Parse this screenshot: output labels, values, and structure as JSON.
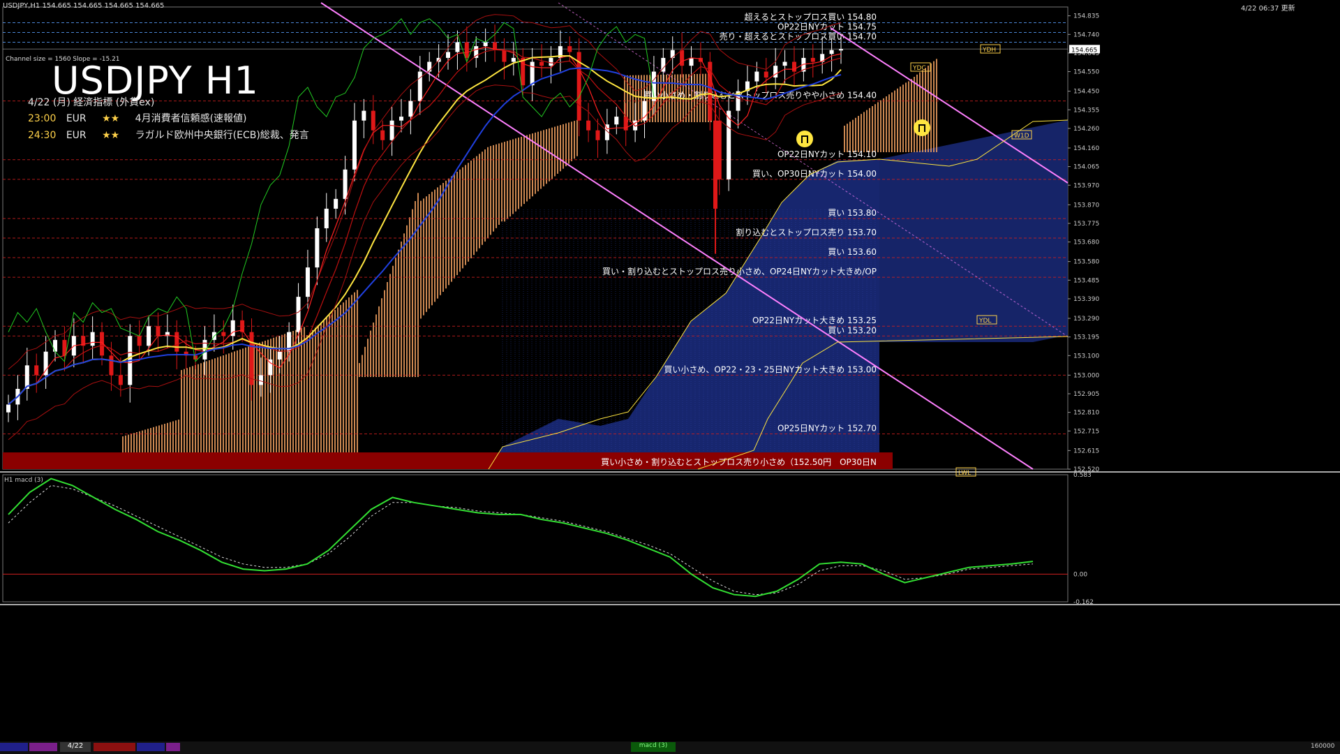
{
  "header": {
    "symbol_info": "USDJPY,H1  154.665 154.665 154.665 154.665",
    "timestamp": "4/22 06:37 更新",
    "channel_info": "Channel size = 1560 Slope = -15.21"
  },
  "title": "USDJPY H1",
  "events": {
    "heading": "4/22 (月) 経済指標 (外貨ex)",
    "items": [
      {
        "time": "23:00",
        "currency": "EUR",
        "stars": "★★",
        "name": "4月消費者信頼感(速報値)"
      },
      {
        "time": "24:30",
        "currency": "EUR",
        "stars": "★★",
        "name": "ラガルド欧州中央銀行(ECB)総裁、発言"
      }
    ]
  },
  "price_levels": [
    {
      "price": 154.8,
      "label": "超えるとストップロス買い 154.80",
      "color": "#5aa0ff",
      "style": "dash"
    },
    {
      "price": 154.75,
      "label": "OP22日NYカット 154.75",
      "color": "#5aa0ff",
      "style": "dash"
    },
    {
      "price": 154.7,
      "label": "売り・超えるとストップロス買い 154.70",
      "color": "#5aa0ff",
      "style": "dash"
    },
    {
      "price": 154.4,
      "label": "買い小さめ・割り込むとストップロス売りやや小さめ 154.40",
      "color": "#d02020",
      "style": "dash"
    },
    {
      "price": 154.1,
      "label": "OP22日NYカット 154.10",
      "color": "#d02020",
      "style": "dash"
    },
    {
      "price": 154.0,
      "label": "買い、OP30日NYカット 154.00",
      "color": "#d02020",
      "style": "dash"
    },
    {
      "price": 153.8,
      "label": "買い 153.80",
      "color": "#d02020",
      "style": "dash"
    },
    {
      "price": 153.7,
      "label": "割り込むとストップロス売り 153.70",
      "color": "#d02020",
      "style": "dash"
    },
    {
      "price": 153.6,
      "label": "買い 153.60",
      "color": "#d02020",
      "style": "dash"
    },
    {
      "price": 153.5,
      "label": "買い・割り込むとストップロス売り小さめ、OP24日NYカット大きめ/OP",
      "color": "#d02020",
      "style": "dash"
    },
    {
      "price": 153.25,
      "label": "OP22日NYカット大きめ 153.25",
      "color": "#d02020",
      "style": "dash"
    },
    {
      "price": 153.2,
      "label": "買い 153.20",
      "color": "#d02020",
      "style": "dash"
    },
    {
      "price": 153.0,
      "label": "買い小さめ、OP22・23・25日NYカット大きめ 153.00",
      "color": "#d02020",
      "style": "dash"
    },
    {
      "price": 152.7,
      "label": "OP25日NYカット 152.70",
      "color": "#d02020",
      "style": "dash"
    },
    {
      "price": 152.5,
      "label": "買い小さめ・割り込むとストップロス売り小さめ（152.50円　OP30日N",
      "color": "#d02020",
      "style": "band"
    }
  ],
  "markers": [
    {
      "label": "YDH",
      "price": 154.665
    },
    {
      "label": "YDC",
      "price": 154.59
    },
    {
      "label": "W1D",
      "price": 154.36
    },
    {
      "label": "YDL",
      "price": 153.58
    },
    {
      "label": "LWL",
      "price": 152.96
    }
  ],
  "current_price": "154.665",
  "chart_data": {
    "type": "candlestick",
    "title": "USDJPY H1",
    "ylim": [
      152.52,
      154.88
    ],
    "y_ticks": [
      "154.835",
      "154.740",
      "154.645",
      "154.550",
      "154.450",
      "154.355",
      "154.260",
      "154.160",
      "154.065",
      "153.970",
      "153.870",
      "153.775",
      "153.680",
      "153.580",
      "153.485",
      "153.390",
      "153.290",
      "153.195",
      "153.100",
      "153.000",
      "152.905",
      "152.810",
      "152.715",
      "152.615",
      "152.520"
    ],
    "close_path_approx": [
      152.85,
      152.93,
      153.05,
      153.0,
      153.12,
      153.18,
      153.1,
      153.2,
      153.15,
      153.22,
      153.1,
      153.0,
      152.95,
      153.2,
      153.15,
      153.25,
      153.2,
      153.22,
      153.12,
      153.1,
      153.08,
      153.18,
      153.22,
      153.2,
      153.28,
      153.22,
      152.95,
      153.0,
      153.08,
      153.12,
      153.22,
      153.4,
      153.55,
      153.75,
      153.85,
      153.9,
      154.05,
      154.3,
      154.35,
      154.25,
      154.2,
      154.3,
      154.32,
      154.4,
      154.55,
      154.6,
      154.62,
      154.65,
      154.7,
      154.62,
      154.68,
      154.7,
      154.66,
      154.6,
      154.62,
      154.48,
      154.6,
      154.58,
      154.62,
      154.68,
      154.65,
      154.3,
      154.25,
      154.2,
      154.28,
      154.32,
      154.25,
      154.3,
      154.4,
      154.55,
      154.62,
      154.66,
      154.58,
      154.62,
      154.6,
      154.3,
      154.0,
      154.35,
      154.45,
      154.5,
      154.55,
      154.52,
      154.58,
      154.6,
      154.55,
      154.62,
      154.6,
      154.64,
      154.66,
      154.665
    ],
    "macd": {
      "title": "H1  macd (3)",
      "ylim": [
        -0.162,
        0.583
      ],
      "y_ticks": [
        "0.583",
        "0.00",
        "-0.162"
      ],
      "main_approx": [
        0.35,
        0.48,
        0.56,
        0.52,
        0.45,
        0.38,
        0.32,
        0.25,
        0.2,
        0.14,
        0.07,
        0.03,
        0.02,
        0.03,
        0.06,
        0.14,
        0.26,
        0.38,
        0.45,
        0.42,
        0.4,
        0.38,
        0.36,
        0.35,
        0.35,
        0.32,
        0.3,
        0.27,
        0.24,
        0.2,
        0.15,
        0.1,
        0.0,
        -0.08,
        -0.12,
        -0.13,
        -0.1,
        -0.03,
        0.06,
        0.07,
        0.06,
        0.0,
        -0.05,
        -0.02,
        0.01,
        0.04,
        0.05,
        0.06,
        0.075
      ],
      "signal_approx": [
        0.3,
        0.42,
        0.52,
        0.5,
        0.45,
        0.4,
        0.34,
        0.28,
        0.22,
        0.16,
        0.1,
        0.06,
        0.04,
        0.04,
        0.06,
        0.12,
        0.22,
        0.34,
        0.42,
        0.42,
        0.4,
        0.39,
        0.37,
        0.36,
        0.35,
        0.33,
        0.31,
        0.28,
        0.25,
        0.21,
        0.17,
        0.12,
        0.04,
        -0.04,
        -0.1,
        -0.12,
        -0.11,
        -0.06,
        0.02,
        0.05,
        0.05,
        0.02,
        -0.03,
        -0.02,
        0.0,
        0.03,
        0.04,
        0.05,
        0.06
      ]
    }
  },
  "bottom_bar": {
    "date_label": "4/22",
    "macd_label": "macd (3)",
    "right_value": "160000"
  },
  "colors": {
    "background": "#000000",
    "bull_candle": "#ffffff",
    "bear_candle": "#e01818",
    "kumo": "#f0a060",
    "kumo_blue": "#1a2a7a",
    "ma_yellow": "#ffe640",
    "ma_blue": "#2040e0",
    "macd_main": "#33e033",
    "macd_signal": "#dddddd",
    "channel": "#ff80ff",
    "bottom_band": "#8b0000"
  }
}
